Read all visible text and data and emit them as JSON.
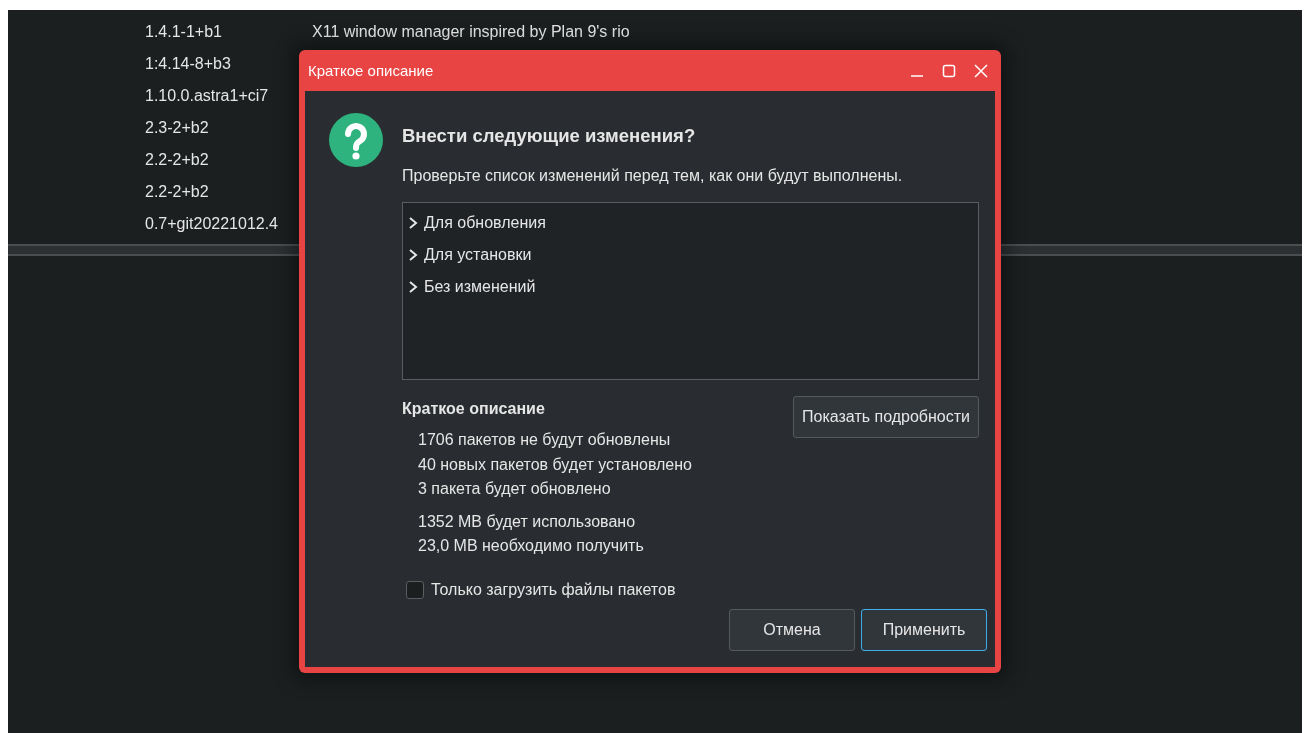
{
  "background_list": {
    "rows": [
      {
        "version": "1.4.1-1+b1",
        "description": "X11 window manager inspired by Plan 9's rio"
      },
      {
        "version": "1:4.14-8+b3"
      },
      {
        "version": "1.10.0.astra1+ci7"
      },
      {
        "version": "2.3-2+b2"
      },
      {
        "version": "2.2-2+b2"
      },
      {
        "version": "2.2-2+b2"
      },
      {
        "version": "0.7+git20221012.4"
      }
    ]
  },
  "dialog": {
    "title": "Краткое описание",
    "heading": "Внести следующие изменения?",
    "subtitle": "Проверьте список изменений перед тем, как они будут выполнены.",
    "tree": [
      {
        "label": "Для обновления",
        "expanded": false
      },
      {
        "label": "Для установки",
        "expanded": false
      },
      {
        "label": "Без изменений",
        "expanded": false
      }
    ],
    "summary_title": "Краткое описание",
    "details_button": "Показать подробности",
    "summary_groups": [
      [
        "1706 пакетов не будут обновлены",
        "40 новых пакетов будет установлено",
        "3 пакета будет обновлено"
      ],
      [
        "1352 MB будет использовано",
        "23,0 MB необходимо получить"
      ]
    ],
    "checkbox": {
      "label": "Только загрузить файлы пакетов",
      "checked": false
    },
    "buttons": [
      {
        "label": "Отмена",
        "focused": false
      },
      {
        "label": "Применить",
        "focused": true
      }
    ]
  }
}
